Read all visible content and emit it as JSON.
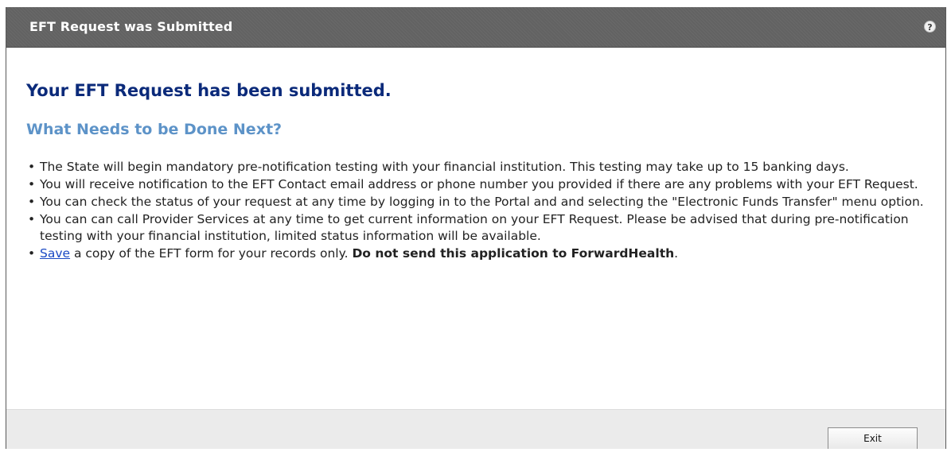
{
  "window": {
    "title": "EFT Request was Submitted",
    "help_icon": "?",
    "help_icon_name": "help-circle-icon"
  },
  "main": {
    "heading": "Your EFT Request has been submitted.",
    "subheading": "What Needs to be Done Next?",
    "items": [
      "The State will begin mandatory pre-notification testing with your financial institution. This testing may take up to 15 banking days.",
      "You will receive notification to the EFT Contact email address or phone number you provided if there are any problems with your EFT Request.",
      "You can check the status of your request at any time by logging in to the Portal and and selecting the \"Electronic Funds Transfer\" menu option.",
      "You can can call Provider Services at any time to get current information on your EFT Request. Please be advised that during pre-notification testing with your financial institution, limited status information will be available."
    ],
    "last_item": {
      "link_text": "Save",
      "text": " a copy of the EFT form for your records only. ",
      "bold_text": "Do not send this application to ForwardHealth",
      "end": "."
    }
  },
  "footer": {
    "exit_label": "Exit"
  },
  "colors": {
    "titlebar": "#666666",
    "heading": "#0b2a7a",
    "subheading": "#5d93c8",
    "link": "#1a49c4",
    "footer": "#ebebeb"
  }
}
